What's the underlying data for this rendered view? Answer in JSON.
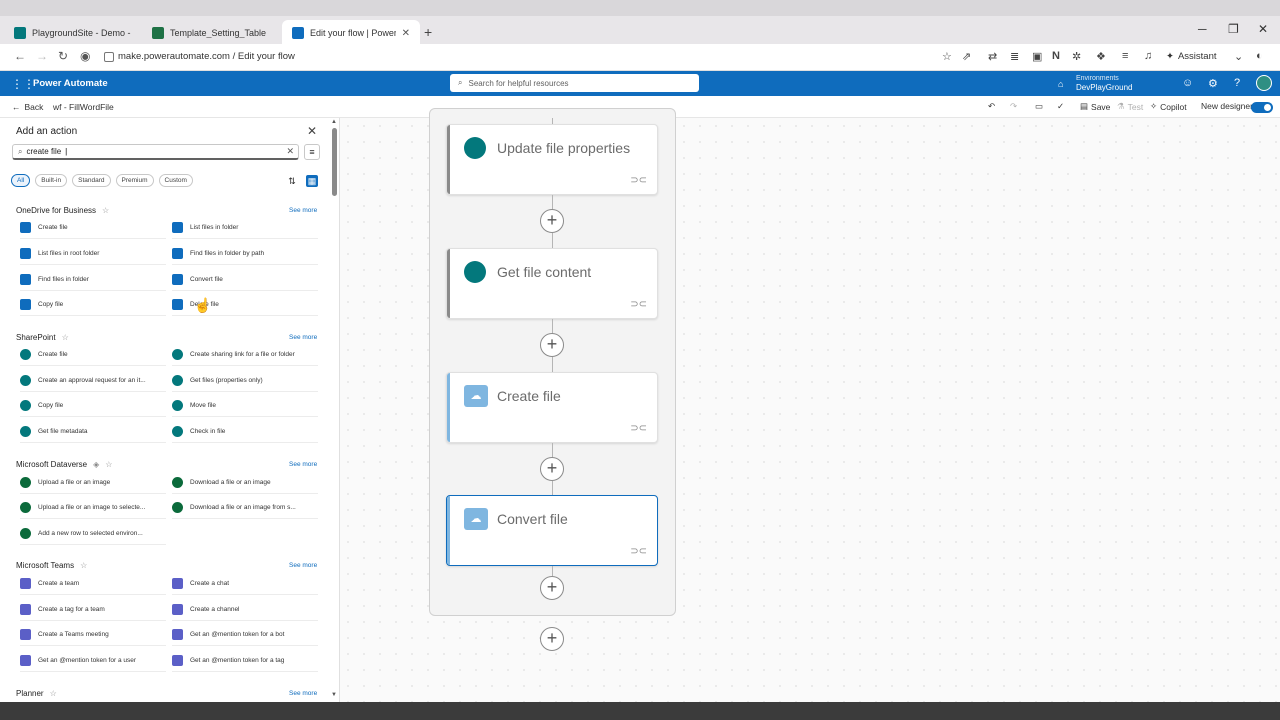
{
  "browser": {
    "tabs": [
      {
        "title": "PlaygroundSite - Demo - All I",
        "color": "#03787c"
      },
      {
        "title": "Template_Setting_Table",
        "color": "#1e7145"
      },
      {
        "title": "Edit your flow | Power Autom...",
        "color": "#0f6cbd"
      }
    ],
    "url": "make.powerautomate.com / Edit your flow",
    "assistant_label": "Assistant"
  },
  "header": {
    "app_name": "Power Automate",
    "search_placeholder": "Search for helpful resources",
    "env_label": "Environments",
    "env_value": "DevPlayGround"
  },
  "cmdbar": {
    "back_label": "Back",
    "flow_name": "wf - FillWordFile",
    "save_label": "Save",
    "test_label": "Test",
    "copilot_label": "Copilot",
    "new_designer_label": "New designer"
  },
  "panel": {
    "title": "Add an action",
    "search_value": "create file",
    "chips": [
      "All",
      "Built-in",
      "Standard",
      "Premium",
      "Custom"
    ],
    "see_more": "See more",
    "groups": [
      {
        "name": "OneDrive for Business",
        "actions": [
          "Create file",
          "List files in folder",
          "List files in root folder",
          "Find files in folder by path",
          "Find files in folder",
          "Convert file",
          "Copy file",
          "Delete file"
        ]
      },
      {
        "name": "SharePoint",
        "actions": [
          "Create file",
          "Create sharing link for a file or folder",
          "Create an approval request for an it...",
          "Get files (properties only)",
          "Copy file",
          "Move file",
          "Get file metadata",
          "Check in file"
        ]
      },
      {
        "name": "Microsoft Dataverse",
        "actions": [
          "Upload a file or an image",
          "Download a file or an image",
          "Upload a file or an image to selecte...",
          "Download a file or an image from s...",
          "Add a new row to selected environ..."
        ]
      },
      {
        "name": "Microsoft Teams",
        "actions": [
          "Create a team",
          "Create a chat",
          "Create a tag for a team",
          "Create a channel",
          "Create a Teams meeting",
          "Get an @mention token for a bot",
          "Get an @mention token for a user",
          "Get an @mention token for a tag"
        ]
      },
      {
        "name": "Planner",
        "actions": []
      }
    ]
  },
  "canvas": {
    "cards": [
      {
        "title": "Update file properties",
        "kind": "sharepoint",
        "color": "#03787c"
      },
      {
        "title": "Get file content",
        "kind": "sharepoint",
        "color": "#03787c"
      },
      {
        "title": "Create file",
        "kind": "onedrive",
        "color": "#0f6cbd"
      },
      {
        "title": "Convert file",
        "kind": "onedrive",
        "color": "#0f6cbd",
        "selected": true
      }
    ]
  }
}
